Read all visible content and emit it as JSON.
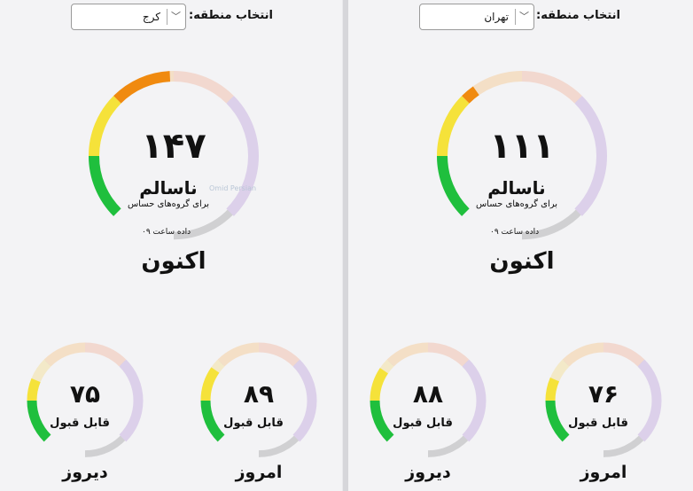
{
  "colors": {
    "good": "#1fbf3d",
    "moderate": "#f5e23a",
    "sensitive": "#f08a0f",
    "unhealthy_faint": "#f2d8cf",
    "very_unhealthy_faint": "#dcd0ea",
    "track": "#d0d0d2",
    "moderate_faint": "#f3e9c8",
    "sensitive_faint": "#f4dfc6",
    "good_faint": "#e4efdc"
  },
  "region_select_label": "انتخاب منطقه:",
  "panels": [
    {
      "id": "karaj",
      "region": "کرج",
      "main": {
        "value": "۱۴۷",
        "aqi": 147,
        "status": "ناسالم",
        "sub": "برای گروه‌های حساس",
        "time": "داده ساعت ۰۹",
        "caption": "اکنون"
      },
      "today": {
        "value": "۸۹",
        "aqi": 89,
        "status": "قابل قبول",
        "caption": "امروز"
      },
      "yesterday": {
        "value": "۷۵",
        "aqi": 75,
        "status": "قابل قبول",
        "caption": "دیروز"
      }
    },
    {
      "id": "tehran",
      "region": "تهران",
      "main": {
        "value": "۱۱۱",
        "aqi": 111,
        "status": "ناسالم",
        "sub": "برای گروه‌های حساس",
        "time": "داده ساعت ۰۹",
        "caption": "اکنون"
      },
      "today": {
        "value": "۷۶",
        "aqi": 76,
        "status": "قابل قبول",
        "caption": "امروز"
      },
      "yesterday": {
        "value": "۸۸",
        "aqi": 88,
        "status": "قابل قبول",
        "caption": "دیروز"
      }
    }
  ],
  "watermark": "Omid Persian"
}
